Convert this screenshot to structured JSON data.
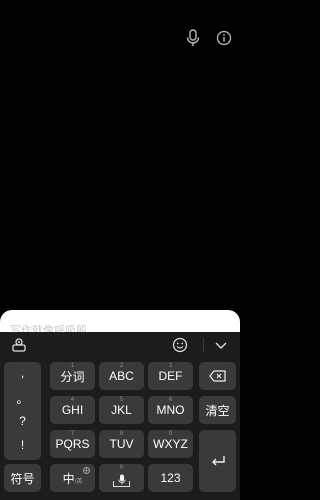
{
  "top_bar": {
    "mic_icon": "microphone-icon",
    "info_icon": "info-icon"
  },
  "input": {
    "placeholder": "写作就像呼吸般"
  },
  "toolbar": {
    "app_icon": "keyboard-app-icon",
    "emoji_icon": "smiley-icon",
    "collapse_icon": "chevron-down-icon"
  },
  "punctuation": [
    ",",
    "。",
    "?",
    "!"
  ],
  "keys": {
    "row1": [
      {
        "num": "1",
        "label": "分词"
      },
      {
        "num": "2",
        "label": "ABC"
      },
      {
        "num": "3",
        "label": "DEF"
      }
    ],
    "row2": [
      {
        "num": "4",
        "label": "GHI"
      },
      {
        "num": "5",
        "label": "JKL"
      },
      {
        "num": "6",
        "label": "MNO"
      }
    ],
    "row3": [
      {
        "num": "7",
        "label": "PQRS"
      },
      {
        "num": "8",
        "label": "TUV"
      },
      {
        "num": "9",
        "label": "WXYZ"
      }
    ],
    "delete_icon": "backspace-icon",
    "clear": "清空",
    "enter_icon": "enter-icon",
    "symbols": "符号",
    "lang_main": "中",
    "lang_sub": "/英",
    "space_num": "0",
    "numbers": "123"
  }
}
